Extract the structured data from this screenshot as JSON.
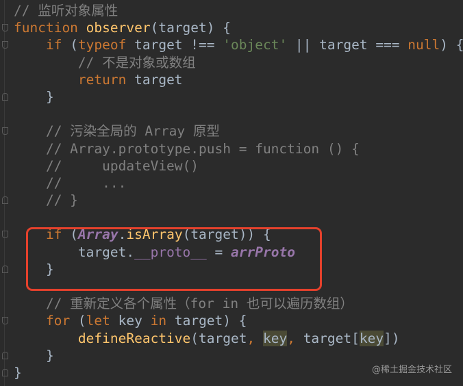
{
  "editor": {
    "lines": [
      {
        "fold": "",
        "tokens": [
          [
            "// 监听对象属性",
            "comment"
          ]
        ]
      },
      {
        "fold": "open",
        "tokens": [
          [
            "function ",
            "keyword"
          ],
          [
            "observer",
            "func"
          ],
          [
            "(target) {",
            "plain"
          ]
        ]
      },
      {
        "fold": "open",
        "tokens": [
          [
            "    if ",
            "keyword"
          ],
          [
            "(",
            "plain"
          ],
          [
            "typeof ",
            "keyword"
          ],
          [
            "target !== ",
            "plain"
          ],
          [
            "'object'",
            "string"
          ],
          [
            " || target === ",
            "plain"
          ],
          [
            "null",
            "keyword"
          ],
          [
            ") {",
            "plain"
          ]
        ]
      },
      {
        "fold": "",
        "tokens": [
          [
            "        // 不是对象或数组",
            "comment"
          ]
        ]
      },
      {
        "fold": "",
        "tokens": [
          [
            "        return ",
            "keyword"
          ],
          [
            "target",
            "plain"
          ]
        ]
      },
      {
        "fold": "close",
        "tokens": [
          [
            "    }",
            "plain"
          ]
        ]
      },
      {
        "fold": "",
        "tokens": []
      },
      {
        "fold": "open",
        "tokens": [
          [
            "    // 污染全局的 Array 原型",
            "comment"
          ]
        ]
      },
      {
        "fold": "",
        "tokens": [
          [
            "    // Array.prototype.push = function () {",
            "comment"
          ]
        ]
      },
      {
        "fold": "",
        "tokens": [
          [
            "    //     updateView()",
            "comment"
          ]
        ]
      },
      {
        "fold": "",
        "tokens": [
          [
            "    //     ...",
            "comment"
          ]
        ]
      },
      {
        "fold": "close",
        "tokens": [
          [
            "    // }",
            "comment"
          ]
        ]
      },
      {
        "fold": "",
        "tokens": []
      },
      {
        "fold": "open",
        "tokens": [
          [
            "    if ",
            "keyword"
          ],
          [
            "(",
            "plain"
          ],
          [
            "Array",
            "purple-italic"
          ],
          [
            ".",
            "plain"
          ],
          [
            "isArray",
            "func"
          ],
          [
            "(target)) {",
            "plain"
          ]
        ]
      },
      {
        "fold": "",
        "tokens": [
          [
            "        target.",
            "plain"
          ],
          [
            "__proto__",
            "purple"
          ],
          [
            " = ",
            "plain"
          ],
          [
            "arrProto",
            "purple-italic"
          ]
        ]
      },
      {
        "fold": "close",
        "tokens": [
          [
            "    }",
            "plain"
          ]
        ]
      },
      {
        "fold": "",
        "tokens": []
      },
      {
        "fold": "",
        "tokens": [
          [
            "    // 重新定义各个属性（for in 也可以遍历数组）",
            "comment"
          ]
        ]
      },
      {
        "fold": "open",
        "tokens": [
          [
            "    for ",
            "keyword"
          ],
          [
            "(",
            "plain"
          ],
          [
            "let ",
            "keyword"
          ],
          [
            "key ",
            "plain"
          ],
          [
            "in ",
            "keyword"
          ],
          [
            "target) {",
            "plain"
          ]
        ]
      },
      {
        "fold": "",
        "tokens": [
          [
            "        ",
            "plain"
          ],
          [
            "defineReactive",
            "func"
          ],
          [
            "(target",
            "plain"
          ],
          [
            ", ",
            "keyword"
          ],
          [
            "key",
            "hl"
          ],
          [
            ", ",
            "keyword"
          ],
          [
            "target[",
            "plain"
          ],
          [
            "key",
            "hl"
          ],
          [
            "])",
            "plain"
          ]
        ]
      },
      {
        "fold": "close",
        "tokens": [
          [
            "    }",
            "plain"
          ]
        ]
      },
      {
        "fold": "close",
        "tokens": [
          [
            "}",
            "plain"
          ]
        ]
      }
    ]
  },
  "watermark": "@稀土掘金技术社区",
  "colors": {
    "background": "#2b2b2b",
    "highlight_box": "#e5412c"
  }
}
